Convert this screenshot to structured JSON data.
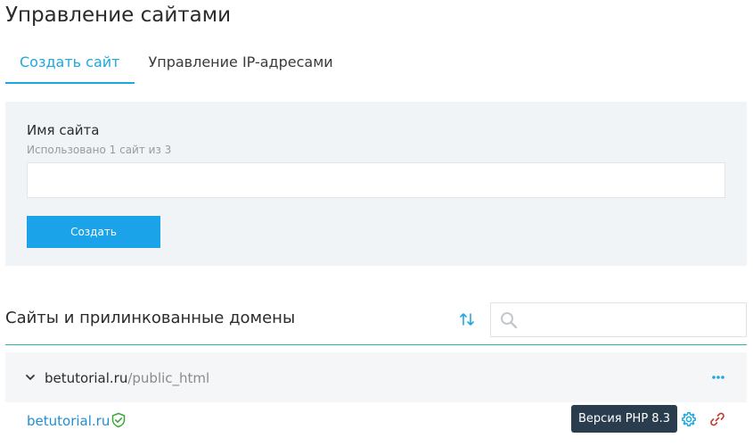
{
  "page": {
    "title": "Управление сайтами"
  },
  "tabs": [
    {
      "label": "Создать сайт",
      "active": true
    },
    {
      "label": "Управление IP-адресами",
      "active": false
    }
  ],
  "create_form": {
    "label": "Имя сайта",
    "hint": "Использовано 1 сайт из 3",
    "input_value": "",
    "input_placeholder": "",
    "button_label": "Создать"
  },
  "sites_section": {
    "title": "Сайты и прилинкованные домены",
    "search_value": "",
    "search_placeholder": "",
    "sort_icon": "sort-arrows-icon",
    "search_icon": "magnifier-icon"
  },
  "site_group": {
    "domain": "betutorial.ru",
    "path": "/public_html",
    "expand_icon": "chevron-down-icon",
    "menu_icon": "more-dots-icon"
  },
  "site_entry": {
    "domain": "betutorial.ru",
    "ssl_icon": "shield-check-icon",
    "php_badge": "Версия PHP 8.3",
    "settings_icon": "gear-icon",
    "unlink_icon": "unlink-icon"
  },
  "colors": {
    "accent": "#1ea8de",
    "button": "#1aa3e8",
    "divider": "#2fb7a6",
    "ssl_green": "#3aa63a",
    "unlink_red": "#c0392b",
    "badge_bg": "#2a3d4f"
  }
}
